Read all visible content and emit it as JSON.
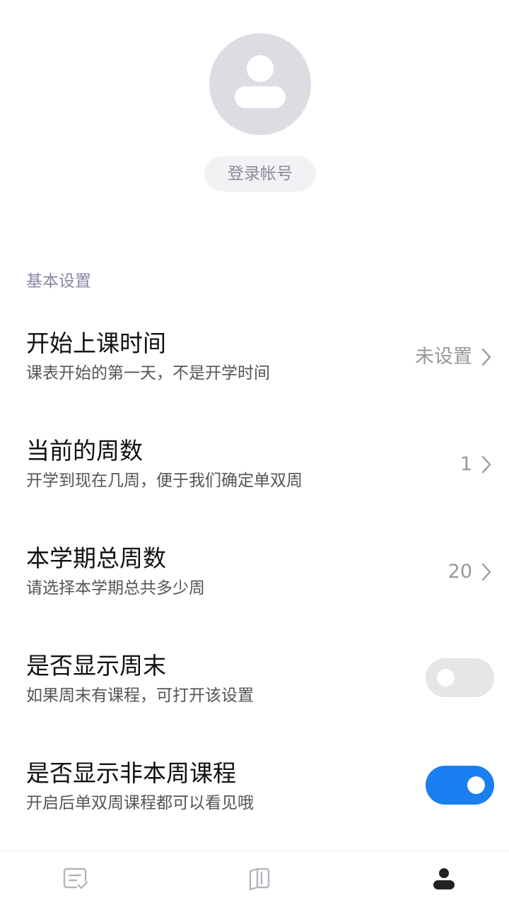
{
  "profile": {
    "avatar_icon": "user-avatar-icon",
    "login_label": "登录帐号"
  },
  "section": {
    "title": "基本设置"
  },
  "settings": [
    {
      "title": "开始上课时间",
      "subtitle": "课表开始的第一天，不是开学时间",
      "value": "未设置",
      "control": "chevron"
    },
    {
      "title": "当前的周数",
      "subtitle": "开学到现在几周，便于我们确定单双周",
      "value": "1",
      "control": "chevron"
    },
    {
      "title": "本学期总周数",
      "subtitle": "请选择本学期总共多少周",
      "value": "20",
      "control": "chevron"
    },
    {
      "title": "是否显示周末",
      "subtitle": "如果周末有课程，可打开该设置",
      "control": "toggle",
      "toggle_on": false
    },
    {
      "title": "是否显示非本周课程",
      "subtitle": "开启后单双周课程都可以看见哦",
      "control": "toggle",
      "toggle_on": true
    }
  ],
  "colors": {
    "accent": "#1a7ff0",
    "toggle_off": "#e6e6e9",
    "section_title": "#8888a8"
  },
  "bottom_nav": [
    {
      "icon": "schedule-icon",
      "active": false
    },
    {
      "icon": "books-icon",
      "active": false
    },
    {
      "icon": "profile-icon",
      "active": true
    }
  ]
}
